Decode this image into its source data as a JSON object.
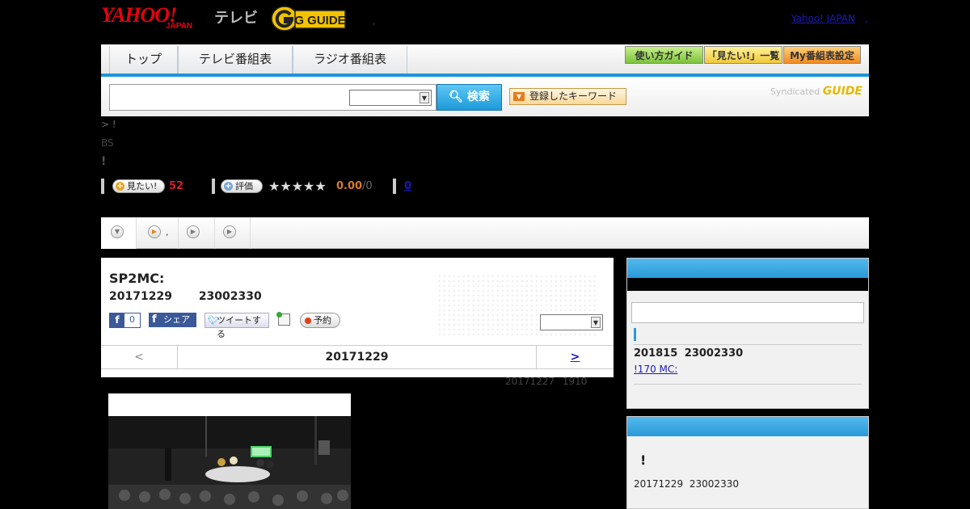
{
  "header": {
    "logo_yahoo": "YAHOO!",
    "logo_japan": "JAPAN",
    "logo_tv": "テレビ",
    "logo_gguide": "G GUIDE",
    "yahoo_japan_link": "Yahoo! JAPAN",
    "link_separator": ","
  },
  "nav": {
    "tabs": [
      {
        "label": "トップ"
      },
      {
        "label": "テレビ番組表"
      },
      {
        "label": "ラジオ番組表"
      }
    ],
    "buttons": [
      {
        "label": "使い方ガイド",
        "color": "#8ed14a"
      },
      {
        "label": "「見たい!」一覧",
        "color": "#f2d34a"
      },
      {
        "label": "My番組表設定",
        "color": "#f5a02e"
      }
    ],
    "accent": "#1a96d8"
  },
  "search": {
    "query": "",
    "select_value": "",
    "search_button": "検索",
    "keyword_button": "登録したキーワード",
    "syndicated": "Syndicated",
    "syndicated_logo": "GUIDE"
  },
  "info": {
    "breadcrumb": "> !",
    "channel": "BS",
    "title_mark": "!",
    "want_label": "見たい!",
    "want_count": "52",
    "rate_label": "評価",
    "stars": "★★★★★",
    "rating": "0.00",
    "rating_max": "/0",
    "review_count": "0"
  },
  "subtabs": [
    {
      "icon": "chevron-down-icon",
      "label": ""
    },
    {
      "icon": "play-icon",
      "label": ","
    },
    {
      "icon": "play-icon",
      "label": ""
    },
    {
      "icon": "play-icon",
      "label": ""
    }
  ],
  "program": {
    "title": "SP2MC:",
    "date": "20171229",
    "time": "23002330",
    "fb_count": "0",
    "share_label": "シェア",
    "tweet_label": "ツイートする",
    "reserve_label": "予約",
    "select_value": "",
    "prev_day": "<",
    "current_day": "20171229",
    "next_day": ">",
    "updated": "20171227  1910"
  },
  "sidebar": {
    "search_value": "",
    "entry_date": "201815  23002330",
    "entry_link": "!170 MC: ",
    "box2_title": "!",
    "box2_date": "20171229  23002330",
    "header_color": "#2a99d8"
  }
}
